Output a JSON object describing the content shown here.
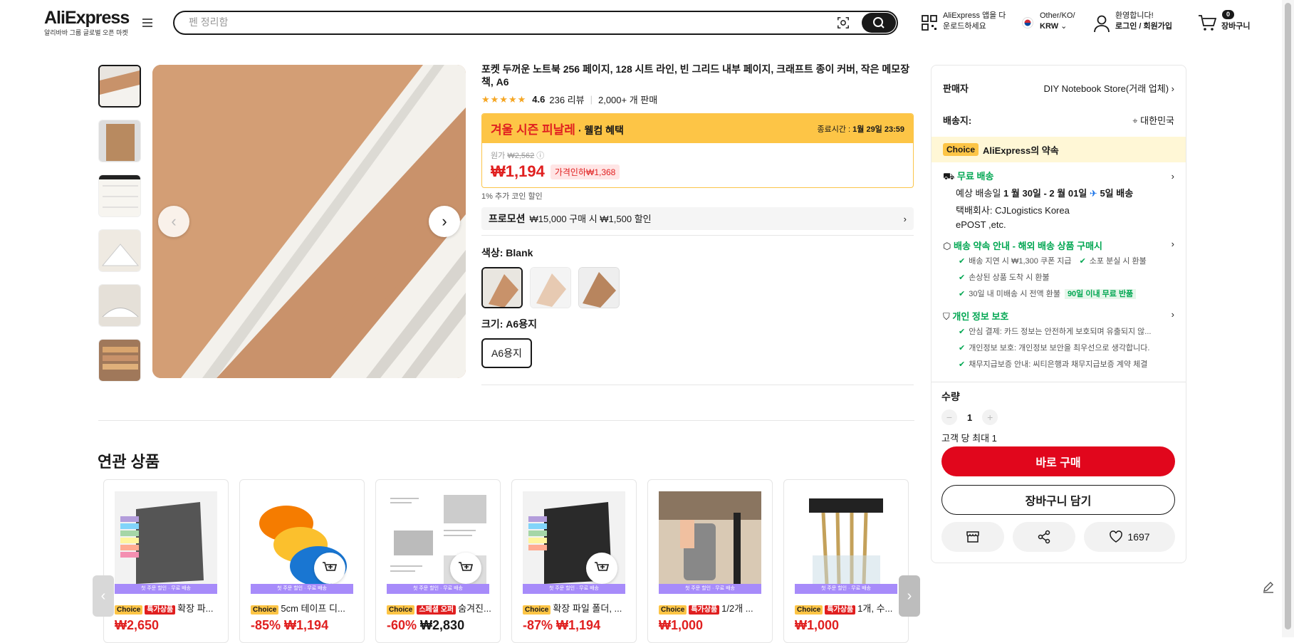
{
  "header": {
    "logo": "AliExpress",
    "logo_sub": "알리바바 그룹 글로벌 오픈 마켓",
    "search_placeholder": "펜 정리함",
    "app_line1": "AliExpress 앱을 다",
    "app_line2": "운로드하세요",
    "region_line1": "Other/KO/",
    "region_line2": "KRW",
    "account_line1": "환영합니다!",
    "account_line2": "로그인 / 회원가입",
    "cart_count": "0",
    "cart_label": "장바구니"
  },
  "product": {
    "title": "포켓 두꺼운 노트북 256 페이지, 128 시트 라인, 빈 그리드 내부 페이지, 크래프트 종이 커버, 작은 메모장 책, A6",
    "rating": "4.6",
    "reviews": "236 리뷰",
    "sold": "2,000+ 개 판매",
    "sale_name": "겨울 시즌 피날레",
    "sale_sub": "· 웰컴 혜택",
    "end_label": "종료시간 :",
    "end_time": "1월 29일 23:59",
    "orig_label": "원가",
    "orig_price": "₩2,562",
    "price": "₩1,194",
    "discount": "가격인하₩1,368",
    "coin": "1% 추가 코인 할인",
    "promo_label": "프로모션",
    "promo_text": "₩15,000 구매 시 ₩1,500 할인",
    "color_label": "색상: Blank",
    "size_label": "크기: A6용지",
    "size_option": "A6용지"
  },
  "side": {
    "seller_label": "판매자",
    "seller_value": "DIY Notebook Store(거래 업체)",
    "ship_to_label": "배송지:",
    "ship_to_value": "대한민국",
    "choice_tag": "Choice",
    "choice_text": "AliExpress의 약속",
    "free_ship": "무료 배송",
    "eta_prefix": "예상 배송일",
    "eta_dates": "1 월 30일 - 2 월 01일",
    "eta_days": "5일 배송",
    "carrier_line1": "택배회사:  CJLogistics  Korea",
    "carrier_line2": "ePOST ,etc.",
    "promise_title": "배송 약속 안내 - 해외 배송 상품 구매시",
    "promise_items": [
      "배송 지연 시 ₩1,300 쿠폰 지급",
      "소포 분실 시 환불",
      "손상된 상품 도착 시 환불",
      "30일 내 미배송 시 전액 환불"
    ],
    "return_tag": "90일 이내 무료 반품",
    "privacy_title": "개인 정보 보호",
    "privacy_items": [
      "안심 결제: 카드 정보는 안전하게 보호되며 유출되지 않...",
      "개인정보 보호: 개인정보 보안을 최우선으로 생각합니다.",
      "채무지급보증 안내: 씨티은행과 채무지급보증 계약 체결"
    ],
    "qty_label": "수량",
    "qty_value": "1",
    "qty_limit": "고객 당 최대 1",
    "buy_now": "바로 구매",
    "add_cart": "장바구니 담기",
    "wish_count": "1697"
  },
  "related": {
    "title": "연관 상품",
    "banner": "첫 주문 할인 · 무료 배송",
    "items": [
      {
        "tag": "특가상품",
        "name": "확장 파...",
        "discount": "",
        "price": "₩2,650"
      },
      {
        "tag": "",
        "name": "5cm 테이프 디...",
        "discount": "-85%",
        "price": "₩1,194"
      },
      {
        "tag": "스페셜 오퍼",
        "name": "숨겨진...",
        "discount": "-60%",
        "price": "₩2,830"
      },
      {
        "tag": "",
        "name": "확장 파일 폴더, ...",
        "discount": "-87%",
        "price": "₩1,194"
      },
      {
        "tag": "특가상품",
        "name": "1/2개 ...",
        "discount": "",
        "price": "₩1,000"
      },
      {
        "tag": "특가상품",
        "name": "1개, 수...",
        "discount": "",
        "price": "₩1,000"
      }
    ]
  },
  "colors": {
    "accent": "#e02020",
    "choice": "#fdc546",
    "green": "#00a651",
    "kraft": "#c8926a"
  }
}
